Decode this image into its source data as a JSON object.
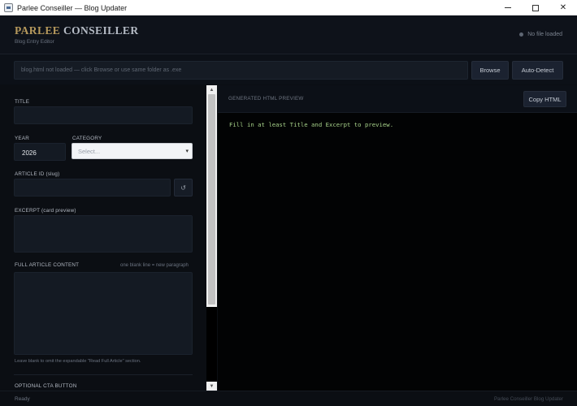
{
  "window": {
    "title": "Parlee Conseiller — Blog Updater",
    "controls": {
      "minimize": "–",
      "maximize": "□",
      "close": "✕"
    }
  },
  "header": {
    "brand_primary": "PARLEE",
    "brand_secondary": "CONSEILLER",
    "subtitle": "Blog Entry Editor",
    "file_status": "No file loaded"
  },
  "pathbar": {
    "placeholder": "blog.html not loaded — click Browse or use same folder as .exe",
    "browse_label": "Browse",
    "auto_detect_label": "Auto-Detect"
  },
  "form": {
    "title_label": "TITLE",
    "title_value": "",
    "year_label": "YEAR",
    "year_value": "2026",
    "category_label": "CATEGORY",
    "category_selected": "Select...",
    "article_id_label": "ARTICLE ID (slug)",
    "article_id_value": "",
    "refresh_glyph": "↺",
    "excerpt_label": "EXCERPT (card preview)",
    "content_label": "FULL ARTICLE CONTENT",
    "content_hint": "one blank line = new paragraph",
    "content_help": "Leave blank to omit the expandable \"Read Full Article\" section.",
    "cta_label": "OPTIONAL CTA BUTTON"
  },
  "scrollbar": {
    "up": "▲",
    "down": "▼"
  },
  "preview": {
    "title": "GENERATED HTML PREVIEW",
    "copy_label": "Copy HTML",
    "content": "Fill in at least Title and Excerpt to preview."
  },
  "statusbar": {
    "left": "Ready",
    "right": "Parlee Conseiller Blog Updater"
  },
  "colors": {
    "background": "#0b0e13",
    "brand_gold": "#b79a5d",
    "preview_text": "#a6d189"
  }
}
